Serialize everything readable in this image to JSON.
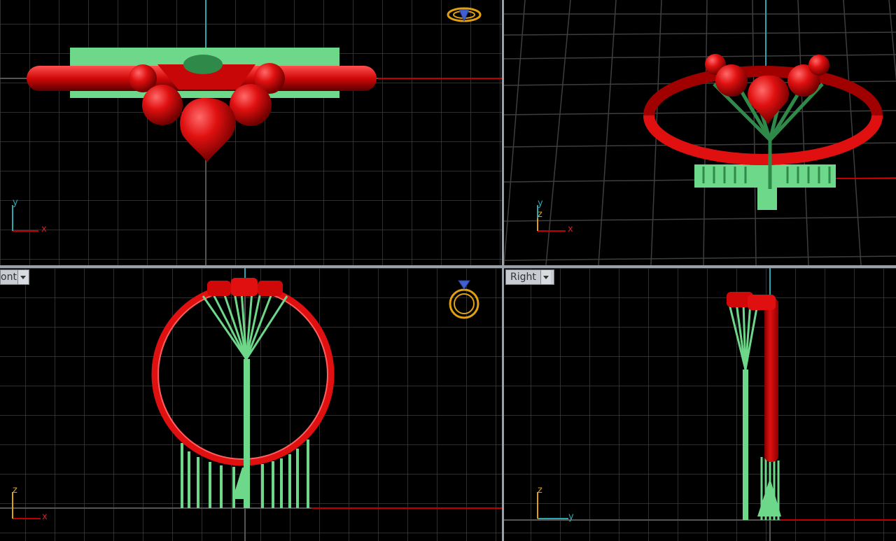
{
  "viewports": {
    "top": {
      "axis_h": "x",
      "axis_v": "y"
    },
    "perspective": {
      "axis_h": "x",
      "axis_v": "y",
      "axis_z": "z"
    },
    "front": {
      "tab_label": "ont",
      "axis_h": "x",
      "axis_v": "z"
    },
    "right": {
      "tab_label": "Right",
      "axis_h": "y",
      "axis_v": "z"
    }
  },
  "colors": {
    "grid": "#3a3a3a",
    "grid_major": "#5a5a5a",
    "ring_red": "#e01010",
    "support_green": "#6ed88a",
    "axis_red": "#c00000",
    "axis_cyan": "#2aa6b0",
    "ring_icon_gold": "#e0a010",
    "gem_icon_blue": "#4060d0"
  },
  "icons": [
    "ring-preview-icon",
    "gem-icon"
  ]
}
